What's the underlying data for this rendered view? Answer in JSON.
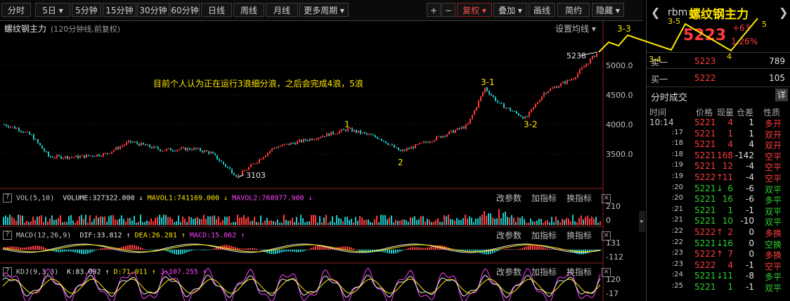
{
  "toolbar": {
    "periods": [
      "分时",
      "5日",
      "5分钟",
      "15分钟",
      "30分钟",
      "60分钟",
      "日线",
      "周线",
      "月线",
      "更多周期"
    ],
    "right_buttons": [
      "+",
      "−",
      "复权",
      "叠加",
      "画线",
      "简约",
      "隐藏"
    ]
  },
  "chart": {
    "title": "螺纹钢主力",
    "subtitle": "(120分钟线,前复权)",
    "settings_label": "设置均线",
    "annotation": "目前个人认为正在运行3浪细分浪，之后会完成4浪，5浪",
    "wave_labels": [
      "1",
      "2",
      "3-1",
      "3-2",
      "3-3",
      "3-4",
      "3-5",
      "4",
      "5"
    ],
    "high_label": "5238",
    "low_label": "3103",
    "y_ticks": [
      "5000.0",
      "4500.0",
      "4000.0",
      "3500.0"
    ]
  },
  "indicators": {
    "vol": {
      "label": "VOL(5,10)",
      "volume": "VOLUME:327322.000",
      "mavol1": "MAVOL1:741169.000",
      "mavol2": "MAVOL2:768977.900",
      "ticks": [
        "210",
        "0"
      ]
    },
    "macd": {
      "label": "MACD(12,26,9)",
      "dif": "DIF:33.812",
      "dea": "DEA:26.281",
      "macd": "MACD:15.062",
      "ticks": [
        "131",
        "-112"
      ]
    },
    "kdj": {
      "label": "KDJ(9,3,3)",
      "k": "K:83.092",
      "d": "D:71.011",
      "j": "J:107.255",
      "ticks": [
        "120",
        "-17"
      ]
    },
    "tools": [
      "改参数",
      "加指标",
      "换指标"
    ]
  },
  "colors": {
    "up": "#ff3c3c",
    "down": "#20c8c8",
    "yellow": "#ffe600",
    "magenta": "#ff40ff",
    "green": "#30d030"
  },
  "panel": {
    "symbol": "rbm",
    "name": "螺纹钢主力",
    "price": "5223",
    "change": "+63",
    "change_pct": "1.26%",
    "sell1_label": "卖一",
    "sell1_price": "5223",
    "sell1_vol": "789",
    "buy1_label": "买一",
    "buy1_price": "5222",
    "buy1_vol": "105",
    "section_title": "分时成交",
    "detail_btn": "详",
    "headers": [
      "时间",
      "价格",
      "现量",
      "仓差",
      "性质"
    ],
    "trades": [
      {
        "time": "10:14",
        "price": "5221",
        "arrow": "",
        "vol": "4",
        "diff": "1",
        "nature": "多开",
        "color": "up"
      },
      {
        "time": ":17",
        "price": "5221",
        "arrow": "",
        "vol": "1",
        "diff": "1",
        "nature": "双开",
        "color": "up"
      },
      {
        "time": ":18",
        "price": "5221",
        "arrow": "",
        "vol": "4",
        "diff": "4",
        "nature": "双开",
        "color": "up"
      },
      {
        "time": ":18",
        "price": "5221",
        "arrow": "",
        "vol": "168",
        "diff": "-142",
        "nature": "空平",
        "color": "up"
      },
      {
        "time": ":19",
        "price": "5221",
        "arrow": "",
        "vol": "12",
        "diff": "-4",
        "nature": "空平",
        "color": "up"
      },
      {
        "time": ":19",
        "price": "5222",
        "arrow": "↑",
        "vol": "11",
        "diff": "-4",
        "nature": "空平",
        "color": "up"
      },
      {
        "time": ":20",
        "price": "5221",
        "arrow": "↓",
        "vol": "6",
        "diff": "-6",
        "nature": "双平",
        "color": "down"
      },
      {
        "time": ":20",
        "price": "5221",
        "arrow": "",
        "vol": "16",
        "diff": "-6",
        "nature": "多平",
        "color": "down"
      },
      {
        "time": ":21",
        "price": "5221",
        "arrow": "",
        "vol": "1",
        "diff": "-1",
        "nature": "双平",
        "color": "down"
      },
      {
        "time": ":21",
        "price": "5221",
        "arrow": "",
        "vol": "10",
        "diff": "-10",
        "nature": "双平",
        "color": "down"
      },
      {
        "time": ":22",
        "price": "5222",
        "arrow": "↑",
        "vol": "2",
        "diff": "0",
        "nature": "多换",
        "color": "up"
      },
      {
        "time": ":22",
        "price": "5221",
        "arrow": "↓",
        "vol": "16",
        "diff": "0",
        "nature": "空换",
        "color": "down"
      },
      {
        "time": ":23",
        "price": "5222",
        "arrow": "↑",
        "vol": "7",
        "diff": "0",
        "nature": "多换",
        "color": "up"
      },
      {
        "time": ":23",
        "price": "5222",
        "arrow": "",
        "vol": "4",
        "diff": "-1",
        "nature": "空平",
        "color": "up"
      },
      {
        "time": ":24",
        "price": "5221",
        "arrow": "↓",
        "vol": "11",
        "diff": "-8",
        "nature": "多平",
        "color": "down"
      },
      {
        "time": ":25",
        "price": "5221",
        "arrow": "",
        "vol": "1",
        "diff": "-1",
        "nature": "双平",
        "color": "down"
      }
    ]
  }
}
